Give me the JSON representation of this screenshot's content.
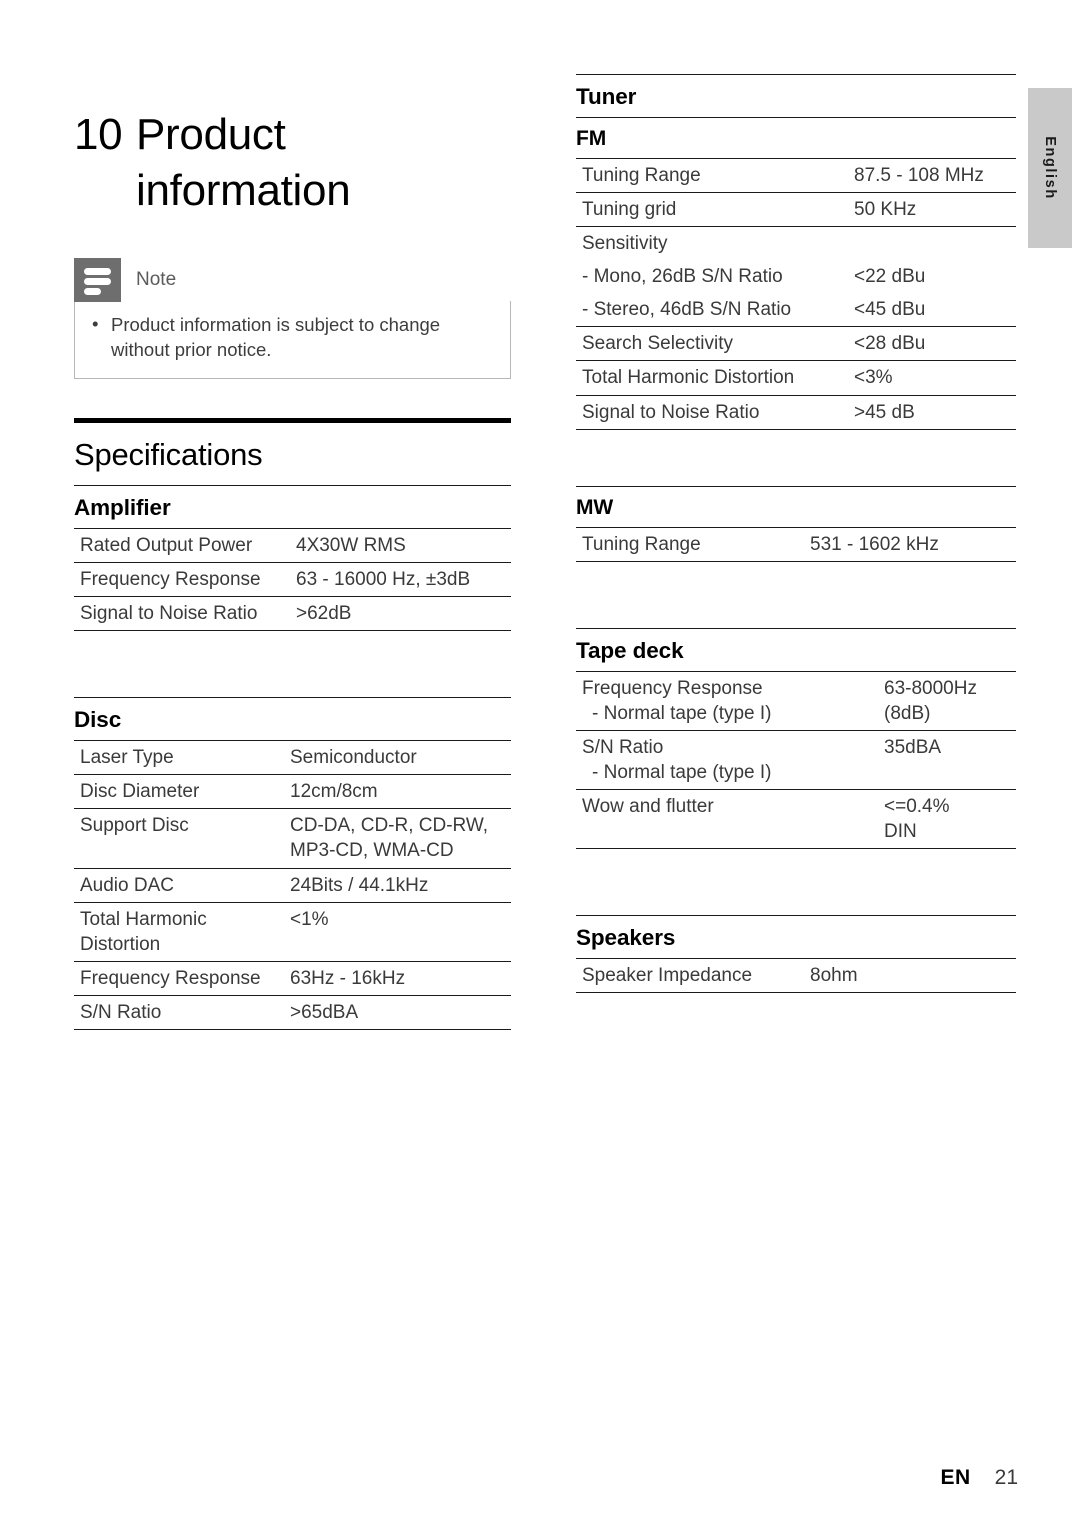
{
  "page": {
    "language_tab": "English",
    "footer_code": "EN",
    "footer_page": "21"
  },
  "chapter": {
    "number": "10",
    "title": "Product information"
  },
  "note": {
    "icon": "note-icon",
    "label": "Note",
    "items": [
      "Product information is subject to change without prior notice."
    ]
  },
  "specifications": {
    "heading": "Specifications",
    "sections": [
      {
        "id": "amplifier",
        "title": "Amplifier",
        "rows": [
          {
            "key": "Rated Output Power",
            "value": "4X30W RMS"
          },
          {
            "key": "Frequency Response",
            "value": "63 - 16000 Hz, ±3dB"
          },
          {
            "key": "Signal to Noise Ratio",
            "value": ">62dB"
          }
        ]
      },
      {
        "id": "disc",
        "title": "Disc",
        "rows": [
          {
            "key": "Laser Type",
            "value": "Semiconductor"
          },
          {
            "key": "Disc Diameter",
            "value": "12cm/8cm"
          },
          {
            "key": "Support Disc",
            "value": "CD-DA, CD-R, CD-RW, MP3-CD, WMA-CD"
          },
          {
            "key": "Audio DAC",
            "value": "24Bits / 44.1kHz"
          },
          {
            "key": "Total Harmonic Distortion",
            "value": "<1%"
          },
          {
            "key": "Frequency Response",
            "value": "63Hz - 16kHz"
          },
          {
            "key": "S/N Ratio",
            "value": ">65dBA"
          }
        ]
      },
      {
        "id": "tuner",
        "title": "Tuner",
        "subsections": [
          {
            "id": "fm",
            "title": "FM",
            "rows": [
              {
                "key": "Tuning Range",
                "value": "87.5 - 108 MHz"
              },
              {
                "key": "Tuning grid",
                "value": "50 KHz"
              },
              {
                "key": "Sensitivity",
                "value": ""
              },
              {
                "key": "- Mono, 26dB S/N Ratio",
                "value": "<22 dBu"
              },
              {
                "key": "- Stereo, 46dB S/N Ratio",
                "value": "<45 dBu"
              },
              {
                "key": "Search Selectivity",
                "value": "<28 dBu"
              },
              {
                "key": "Total Harmonic Distortion",
                "value": "<3%"
              },
              {
                "key": "Signal to Noise Ratio",
                "value": ">45 dB"
              }
            ]
          },
          {
            "id": "mw",
            "title": "MW",
            "rows": [
              {
                "key": "Tuning Range",
                "value": "531 - 1602 kHz"
              }
            ]
          }
        ]
      },
      {
        "id": "tape-deck",
        "title": "Tape deck",
        "rows": [
          {
            "key": "Frequency Response",
            "key2": "- Normal tape (type I)",
            "value": "63-8000Hz",
            "value2": "(8dB)"
          },
          {
            "key": "S/N Ratio",
            "key2": "- Normal tape (type I)",
            "value": "35dBA",
            "value2": ""
          },
          {
            "key": "Wow and flutter",
            "value": "<=0.4%",
            "value2": "DIN"
          }
        ]
      },
      {
        "id": "speakers",
        "title": "Speakers",
        "rows": [
          {
            "key": "Speaker Impedance",
            "value": "8ohm"
          }
        ]
      }
    ]
  }
}
